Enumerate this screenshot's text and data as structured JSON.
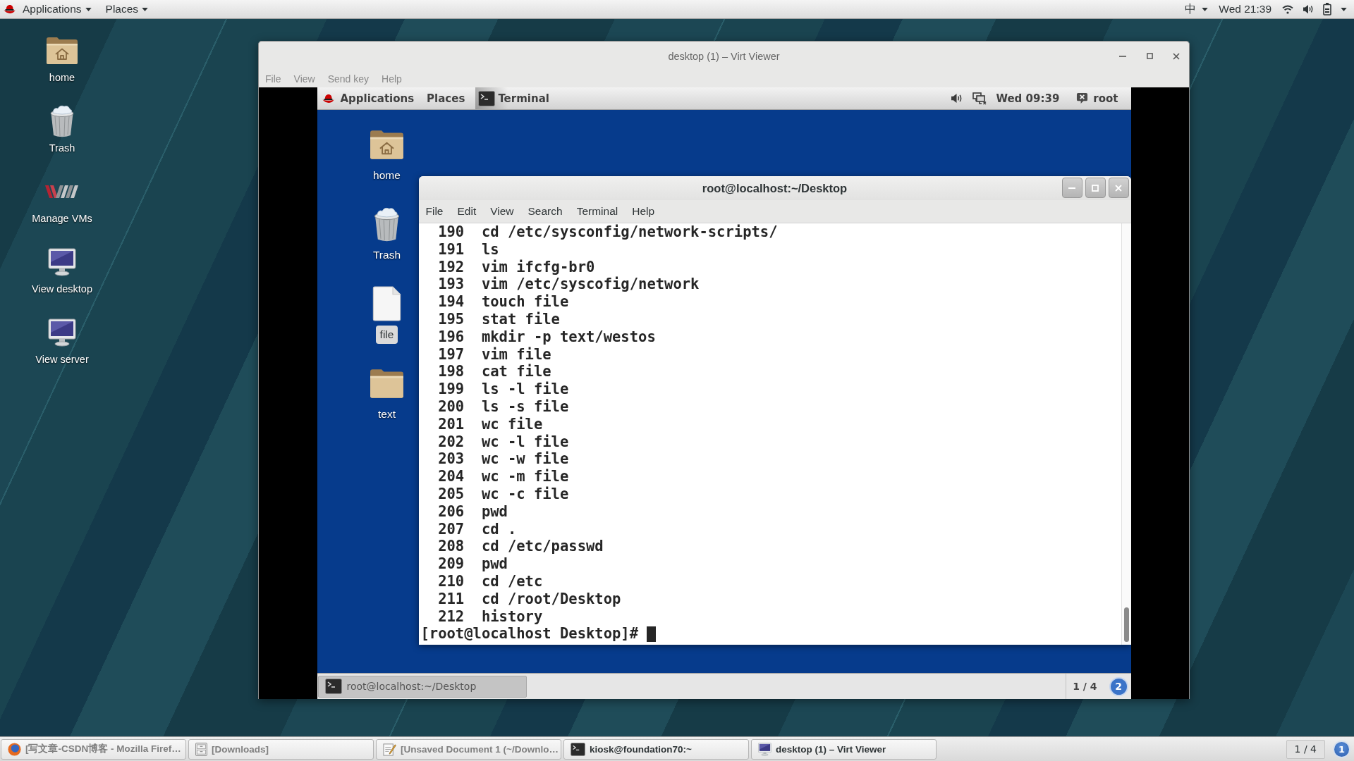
{
  "top_bar": {
    "menus": [
      "Applications",
      "Places"
    ],
    "input_method": "中",
    "clock": "Wed 21:39"
  },
  "desktop_icons": [
    {
      "kind": "home",
      "label": "home",
      "selected": false
    },
    {
      "kind": "trash",
      "label": "Trash",
      "selected": false
    },
    {
      "kind": "vm",
      "label": "Manage VMs",
      "selected": false
    },
    {
      "kind": "monitor",
      "label": "View desktop",
      "selected": false
    },
    {
      "kind": "monitor",
      "label": "View server",
      "selected": false
    }
  ],
  "virt_viewer": {
    "title": "desktop (1) – Virt Viewer",
    "menu": [
      "File",
      "View",
      "Send key",
      "Help"
    ],
    "guest": {
      "top_bar": {
        "menus": [
          "Applications",
          "Places"
        ],
        "app": "Terminal",
        "clock": "Wed 09:39",
        "user": "root"
      },
      "desktop_icons": [
        {
          "kind": "home",
          "label": "home",
          "selected": false
        },
        {
          "kind": "trash",
          "label": "Trash",
          "selected": false
        },
        {
          "kind": "file",
          "label": "file",
          "selected": true
        },
        {
          "kind": "folder",
          "label": "text",
          "selected": false
        }
      ],
      "terminal": {
        "title": "root@localhost:~/Desktop",
        "menu": [
          "File",
          "Edit",
          "View",
          "Search",
          "Terminal",
          "Help"
        ],
        "lines": [
          "190  cd /etc/sysconfig/network-scripts/",
          "191  ls",
          "192  vim ifcfg-br0",
          "193  vim /etc/syscofig/network",
          "194  touch file",
          "195  stat file",
          "196  mkdir -p text/westos",
          "197  vim file",
          "198  cat file",
          "199  ls -l file",
          "200  ls -s file",
          "201  wc file",
          "202  wc -l file",
          "203  wc -w file",
          "204  wc -m file",
          "205  wc -c file",
          "206  pwd",
          "207  cd .",
          "208  cd /etc/passwd",
          "209  pwd",
          "210  cd /etc",
          "211  cd /root/Desktop",
          "212  history"
        ],
        "prompt": "[root@localhost Desktop]#"
      },
      "bottom_bar": {
        "tasks": [
          {
            "label": "root@localhost:~/Desktop",
            "selected": true
          }
        ],
        "workspace": "1 / 4",
        "notifications": "2"
      }
    }
  },
  "taskbar": {
    "tasks": [
      {
        "kind": "browser",
        "label": "[写文章-CSDN博客 - Mozilla Firef…",
        "minimized": true
      },
      {
        "kind": "files",
        "label": "[Downloads]",
        "minimized": true
      },
      {
        "kind": "editor",
        "label": "[Unsaved Document 1 (~/Downlo…",
        "minimized": true
      },
      {
        "kind": "terminal",
        "label": "kiosk@foundation70:~",
        "minimized": false
      },
      {
        "kind": "viewer",
        "label": "desktop (1) – Virt Viewer",
        "minimized": false
      }
    ],
    "workspace": "1 / 4",
    "notifications": "1"
  }
}
